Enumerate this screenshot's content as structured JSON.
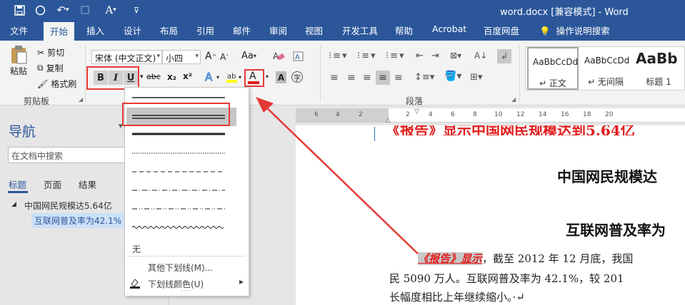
{
  "titlebar": {
    "title": "word.docx [兼容模式]  -  Word",
    "qa_icons": [
      "save-icon",
      "touch-mode-icon",
      "undo-icon",
      "redo-icon",
      "font-style-icon",
      "customize-icon"
    ]
  },
  "tabs": [
    "文件",
    "开始",
    "插入",
    "设计",
    "布局",
    "引用",
    "邮件",
    "审阅",
    "视图",
    "开发工具",
    "帮助",
    "Acrobat",
    "百度网盘",
    "操作说明搜索"
  ],
  "ribbon": {
    "paste_label": "粘贴",
    "cut_label": "剪切",
    "copy_label": "复制",
    "format_painter_label": "格式刷",
    "clipboard_group": "剪贴板",
    "font_name": "宋体 (中文正文)",
    "font_size": "小四",
    "bold": "B",
    "italic": "I",
    "underline": "U",
    "strikethrough": "abc",
    "subscript": "x₂",
    "superscript": "x²",
    "font_color": "A",
    "char_border": "A",
    "phonetic": "字",
    "grow_font": "A",
    "shrink_font": "A",
    "change_case": "Aa",
    "paragraph_group": "段落",
    "styles": [
      {
        "sample": "AaBbCcDd",
        "name": "↵ 正文"
      },
      {
        "sample": "AaBbCcDd",
        "name": "↵ 无间隔"
      },
      {
        "sample": "AaBb",
        "name": "标题 1"
      }
    ]
  },
  "nav": {
    "title": "导航",
    "search_placeholder": "在文档中搜索",
    "tabs": [
      "标题",
      "页面",
      "结果"
    ],
    "items": [
      "中国网民规模达5.64亿",
      "互联网普及率为42.1%"
    ]
  },
  "ruler": {
    "numbers": [
      "6",
      "4",
      "2",
      "2",
      "4",
      "6",
      "8",
      "10",
      "12",
      "14",
      "16",
      "18",
      "20"
    ]
  },
  "document": {
    "heading1": "中国网民规模达",
    "heading2": "互联网普及率为",
    "highlight": "《报告》显示",
    "line1_rest": "，截至 2012 年 12 月底，我国",
    "line2": "民 5090 万人。互联网普及率为 42.1%，较 201",
    "line3": "长幅度相比上年继续缩小。·↵"
  },
  "underline_menu": {
    "none_label": "无",
    "more_label": "其他下划线(M)...",
    "color_label": "下划线颜色(U)",
    "styles": [
      "single",
      "double",
      "thick",
      "dotted",
      "dashed",
      "dash-dot",
      "dash-dot-dot",
      "wave"
    ]
  },
  "colors": {
    "accent": "#2b579a",
    "annotation": "#e53935",
    "doc_red": "#e21b1b"
  }
}
